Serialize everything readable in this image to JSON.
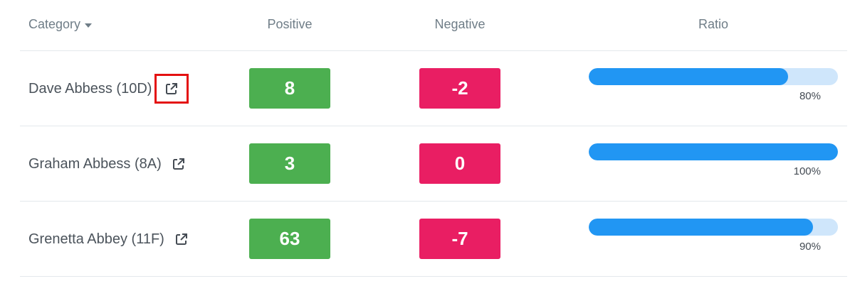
{
  "header": {
    "category": "Category",
    "positive": "Positive",
    "negative": "Negative",
    "ratio": "Ratio"
  },
  "rows": [
    {
      "name": "Dave Abbess (10D)",
      "positive": "8",
      "negative": "-2",
      "ratio_label": "80%",
      "ratio": 0.8,
      "icon": "external-link-icon",
      "highlighted": true
    },
    {
      "name": "Graham Abbess (8A)",
      "positive": "3",
      "negative": "0",
      "ratio_label": "100%",
      "ratio": 1.0,
      "icon": "external-link-icon",
      "highlighted": false
    },
    {
      "name": "Grenetta Abbey (11F)",
      "positive": "63",
      "negative": "-7",
      "ratio_label": "90%",
      "ratio": 0.9,
      "icon": "external-link-icon",
      "highlighted": false
    }
  ],
  "colors": {
    "positive": "#4caf50",
    "negative": "#e91e63",
    "bar_fill": "#2196f3",
    "bar_track": "#cfe6fb",
    "highlight": "#e41010"
  }
}
